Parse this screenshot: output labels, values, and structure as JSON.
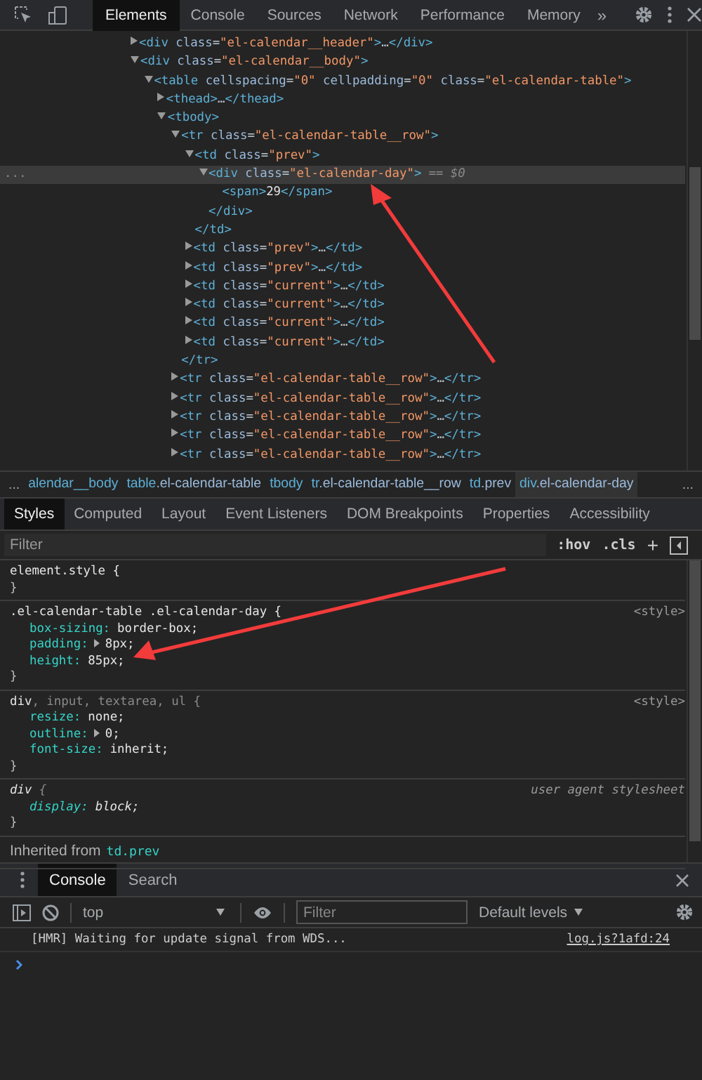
{
  "toolbar": {
    "tabs": [
      {
        "label": "Elements",
        "selected": true
      },
      {
        "label": "Console",
        "selected": false
      },
      {
        "label": "Sources",
        "selected": false
      },
      {
        "label": "Network",
        "selected": false
      },
      {
        "label": "Performance",
        "selected": false
      },
      {
        "label": "Memory",
        "selected": false
      }
    ],
    "more_tabs": "»"
  },
  "elements": {
    "collapsed_mark": "…",
    "selected_suffix": "== $0",
    "selected_gutter": "...",
    "nodes": [
      {
        "kind": "element",
        "open": "<div class=\"el-calendar__header\">",
        "close": "</div>",
        "expanded": false,
        "selected": false
      },
      {
        "kind": "element",
        "open": "<div class=\"el-calendar__body\">",
        "expanded": true,
        "selected": false,
        "children": [
          {
            "kind": "element",
            "open": "<table cellspacing=\"0\" cellpadding=\"0\" class=\"el-calendar-table\">",
            "expanded": true,
            "selected": false,
            "children": [
              {
                "kind": "element",
                "open": "<thead>",
                "close": "</thead>",
                "expanded": false,
                "selected": false
              },
              {
                "kind": "element",
                "open": "<tbody>",
                "expanded": true,
                "selected": false,
                "children": [
                  {
                    "kind": "element",
                    "open": "<tr class=\"el-calendar-table__row\">",
                    "close": "</tr>",
                    "expanded": true,
                    "selected": false,
                    "children": [
                      {
                        "kind": "element",
                        "open": "<td class=\"prev\">",
                        "close": "</td>",
                        "expanded": true,
                        "selected": false,
                        "children": [
                          {
                            "kind": "element",
                            "open": "<div class=\"el-calendar-day\">",
                            "close": "</div>",
                            "expanded": true,
                            "selected": true,
                            "children": [
                              {
                                "kind": "leaf",
                                "open": "<span>",
                                "text": "29",
                                "close": "</span>",
                                "selected": false
                              }
                            ]
                          }
                        ]
                      },
                      {
                        "kind": "element",
                        "open": "<td class=\"prev\">",
                        "close": "</td>",
                        "expanded": false,
                        "selected": false
                      },
                      {
                        "kind": "element",
                        "open": "<td class=\"prev\">",
                        "close": "</td>",
                        "expanded": false,
                        "selected": false
                      },
                      {
                        "kind": "element",
                        "open": "<td class=\"current\">",
                        "close": "</td>",
                        "expanded": false,
                        "selected": false
                      },
                      {
                        "kind": "element",
                        "open": "<td class=\"current\">",
                        "close": "</td>",
                        "expanded": false,
                        "selected": false
                      },
                      {
                        "kind": "element",
                        "open": "<td class=\"current\">",
                        "close": "</td>",
                        "expanded": false,
                        "selected": false
                      },
                      {
                        "kind": "element",
                        "open": "<td class=\"current\">",
                        "close": "</td>",
                        "expanded": false,
                        "selected": false
                      }
                    ]
                  },
                  {
                    "kind": "element",
                    "open": "<tr class=\"el-calendar-table__row\">",
                    "close": "</tr>",
                    "expanded": false,
                    "selected": false
                  },
                  {
                    "kind": "element",
                    "open": "<tr class=\"el-calendar-table__row\">",
                    "close": "</tr>",
                    "expanded": false,
                    "selected": false
                  },
                  {
                    "kind": "element",
                    "open": "<tr class=\"el-calendar-table__row\">",
                    "close": "</tr>",
                    "expanded": false,
                    "selected": false
                  },
                  {
                    "kind": "element",
                    "open": "<tr class=\"el-calendar-table__row\">",
                    "close": "</tr>",
                    "expanded": false,
                    "selected": false
                  },
                  {
                    "kind": "element",
                    "open": "<tr class=\"el-calendar-table__row\">",
                    "close": "</tr>",
                    "expanded": false,
                    "selected": false
                  }
                ]
              }
            ]
          }
        ]
      }
    ]
  },
  "breadcrumbs": {
    "more_left": "...",
    "more_right": "...",
    "items": [
      {
        "label": "alendar__body",
        "selected": false
      },
      {
        "label": "table.el-calendar-table",
        "selected": false
      },
      {
        "label": "tbody",
        "selected": false
      },
      {
        "label": "tr.el-calendar-table__row",
        "selected": false
      },
      {
        "label": "td.prev",
        "selected": false
      },
      {
        "label": "div.el-calendar-day",
        "selected": true
      }
    ]
  },
  "styles": {
    "tabs": [
      {
        "label": "Styles",
        "selected": true
      },
      {
        "label": "Computed",
        "selected": false
      },
      {
        "label": "Layout",
        "selected": false
      },
      {
        "label": "Event Listeners",
        "selected": false
      },
      {
        "label": "DOM Breakpoints",
        "selected": false
      },
      {
        "label": "Properties",
        "selected": false
      },
      {
        "label": "Accessibility",
        "selected": false
      }
    ],
    "filter": {
      "placeholder": "Filter"
    },
    "hov": ":hov",
    "cls": ".cls",
    "new_rule": "+",
    "rules": [
      {
        "user_agent": false,
        "selector": [
          {
            "text": "element.style {",
            "matched": true
          }
        ],
        "close": "}"
      },
      {
        "user_agent": false,
        "selector": [
          {
            "text": ".el-calendar-table .el-calendar-day {",
            "matched": true
          }
        ],
        "source": "<style>",
        "props": [
          {
            "name": "box-sizing:",
            "value": "border-box;",
            "expandable": false
          },
          {
            "name": "padding:",
            "value": "8px;",
            "expandable": true
          },
          {
            "name": "height:",
            "value": "85px;",
            "expandable": false
          }
        ],
        "close": "}"
      },
      {
        "user_agent": false,
        "selector": [
          {
            "text": "div",
            "matched": true
          },
          {
            "text": ", input, textarea, ul {",
            "matched": false
          }
        ],
        "source": "<style>",
        "props": [
          {
            "name": "resize:",
            "value": "none;",
            "expandable": false
          },
          {
            "name": "outline:",
            "value": "0;",
            "expandable": true
          },
          {
            "name": "font-size:",
            "value": "inherit;",
            "expandable": false
          }
        ],
        "close": "}"
      },
      {
        "user_agent": true,
        "selector": [
          {
            "text": "div",
            "matched": true
          },
          {
            "text": " {",
            "matched": false
          }
        ],
        "source": "user agent stylesheet",
        "props": [
          {
            "name": "display:",
            "value": "block;",
            "expandable": false
          }
        ],
        "close": "}"
      }
    ],
    "inherited": {
      "label": "Inherited from",
      "source": "td.prev"
    }
  },
  "console": {
    "tabs": [
      {
        "label": "Console",
        "selected": true
      },
      {
        "label": "Search",
        "selected": false
      }
    ],
    "context": "top",
    "filter": {
      "placeholder": "Filter"
    },
    "levels": "Default levels",
    "messages": [
      {
        "text": "[HMR] Waiting for update signal from WDS...",
        "source": "log.js?1afd:24"
      }
    ]
  }
}
